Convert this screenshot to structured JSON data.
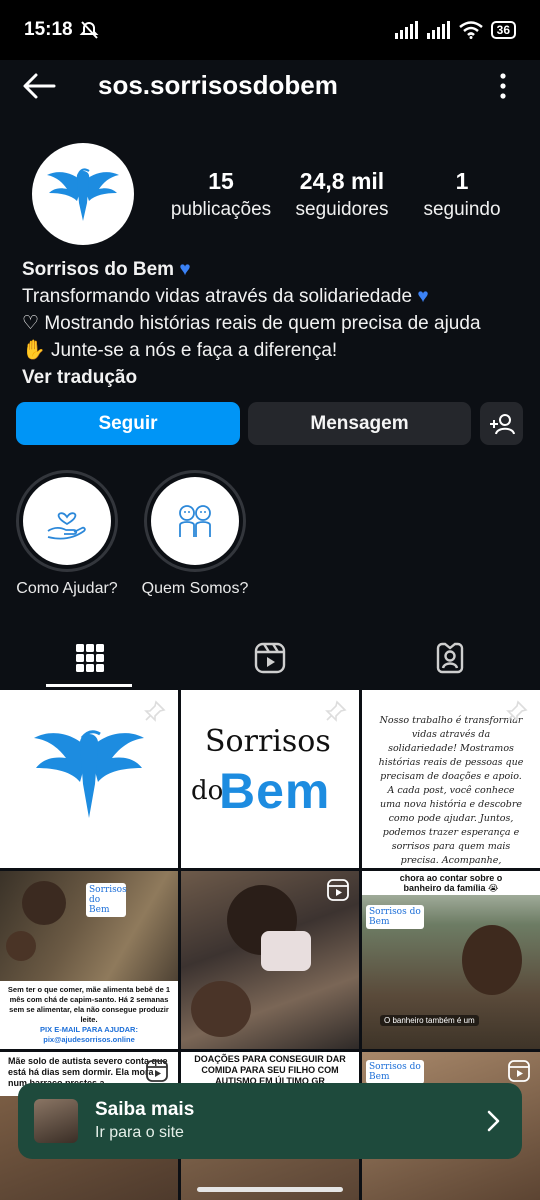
{
  "status_bar": {
    "time": "15:18",
    "battery": "36"
  },
  "header": {
    "username": "sos.sorrisosdobem"
  },
  "stats": [
    {
      "value": "15",
      "label": "publicações"
    },
    {
      "value": "24,8 mil",
      "label": "seguidores"
    },
    {
      "value": "1",
      "label": "seguindo"
    }
  ],
  "bio": {
    "name": "Sorrisos do Bem",
    "line1": "Transformando vidas através da solidariedade",
    "line2": "Mostrando histórias reais de quem precisa de ajuda",
    "line3": "Junte-se a nós e faça a diferença!",
    "translate": "Ver tradução"
  },
  "actions": {
    "follow": "Seguir",
    "message": "Mensagem"
  },
  "highlights": [
    {
      "label": "Como Ajudar?",
      "icon": "hand-heart-icon"
    },
    {
      "label": "Quem Somos?",
      "icon": "people-icon"
    }
  ],
  "tabs": [
    {
      "icon": "grid-icon",
      "active": true
    },
    {
      "icon": "reels-icon",
      "active": false
    },
    {
      "icon": "tagged-icon",
      "active": false
    }
  ],
  "posts": {
    "p2_title_line1": "Sorrisos",
    "p2_title_do": "do",
    "p2_title_bem": "Bem",
    "p3_text": "Nosso trabalho é transformar vidas através da solidariedade! Mostramos histórias reais de pessoas que precisam de doações e apoio. A cada post, você conhece uma nova história e descobre como pode ajudar. Juntos, podemos trazer esperança e sorrisos para quem mais precisa. Acompanhe, compartilhe e faça parte dessa corrente do bem!",
    "p4_brand": "Sorrisos do Bem",
    "p4_caption": "Sem ter o que comer, mãe alimenta bebê de 1 mês com chá de capim-santo. Há 2 semanas sem se alimentar, ela não consegue produzir leite.",
    "p4_pix_label": "PIX E-MAIL PARA AJUDAR:",
    "p4_pix": "pix@ajudesorrisos.online",
    "p6_top": "chora ao contar sobre o banheiro da família 😭",
    "p6_brand": "Sorrisos do Bem",
    "p6_subtitle": "O banheiro também é um",
    "p7_text": "Mãe solo de autista severo conta que está há dias sem dormir. Ela mora num barraco prestes a",
    "p8_text": "DOAÇÕES PARA CONSEGUIR DAR COMIDA PARA SEU FILHO COM AUTISMO EM ÚLTIMO GR",
    "p9_brand": "Sorrisos do Bem"
  },
  "banner": {
    "title": "Saiba mais",
    "subtitle": "Ir para o site"
  },
  "colors": {
    "accent": "#0095f6",
    "brand_blue": "#1d6fd8",
    "banner_bg": "#1e4a3c"
  }
}
